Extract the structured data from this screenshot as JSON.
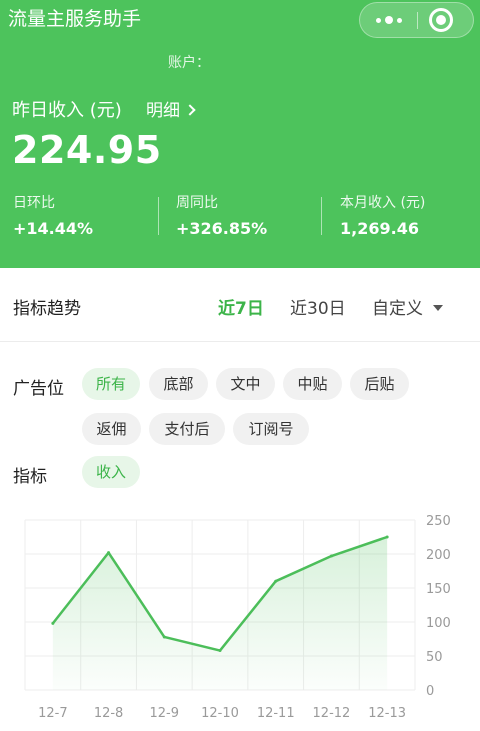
{
  "header": {
    "app_title": "流量主服务助手",
    "account_label": "账户：",
    "income_label": "昨日收入 (元)",
    "detail_link": "明细",
    "income_value": "224.95",
    "stats": [
      {
        "label": "日环比",
        "value": "+14.44%"
      },
      {
        "label": "周同比",
        "value": "+326.85%"
      },
      {
        "label": "本月收入 (元)",
        "value": "1,269.46"
      }
    ]
  },
  "trend": {
    "title": "指标趋势",
    "ranges": [
      "近7日",
      "近30日",
      "自定义"
    ],
    "active_range": "近7日"
  },
  "filters": {
    "ad_position_label": "广告位",
    "ad_positions": [
      "所有",
      "底部",
      "文中",
      "中贴",
      "后贴",
      "返佣",
      "支付后",
      "订阅号"
    ],
    "active_ad_position": "所有",
    "metric_label": "指标",
    "metrics": [
      "收入"
    ],
    "active_metric": "收入"
  },
  "chart_data": {
    "type": "area",
    "categories": [
      "12-7",
      "12-8",
      "12-9",
      "12-10",
      "12-11",
      "12-12",
      "12-13"
    ],
    "series": [
      {
        "values": [
          98,
          202,
          78,
          58,
          160,
          197,
          225
        ]
      }
    ],
    "ylim": [
      0,
      250
    ],
    "yticks": [
      0,
      50,
      100,
      150,
      200,
      250
    ],
    "y_axis_side": "right",
    "grid": true,
    "line_color": "#4cbe5a"
  },
  "colors": {
    "brand_green": "#4dc35c",
    "accent_green": "#3cb449",
    "chip_bg": "#f1f1f1",
    "chip_active_bg": "#e7f6e8"
  }
}
